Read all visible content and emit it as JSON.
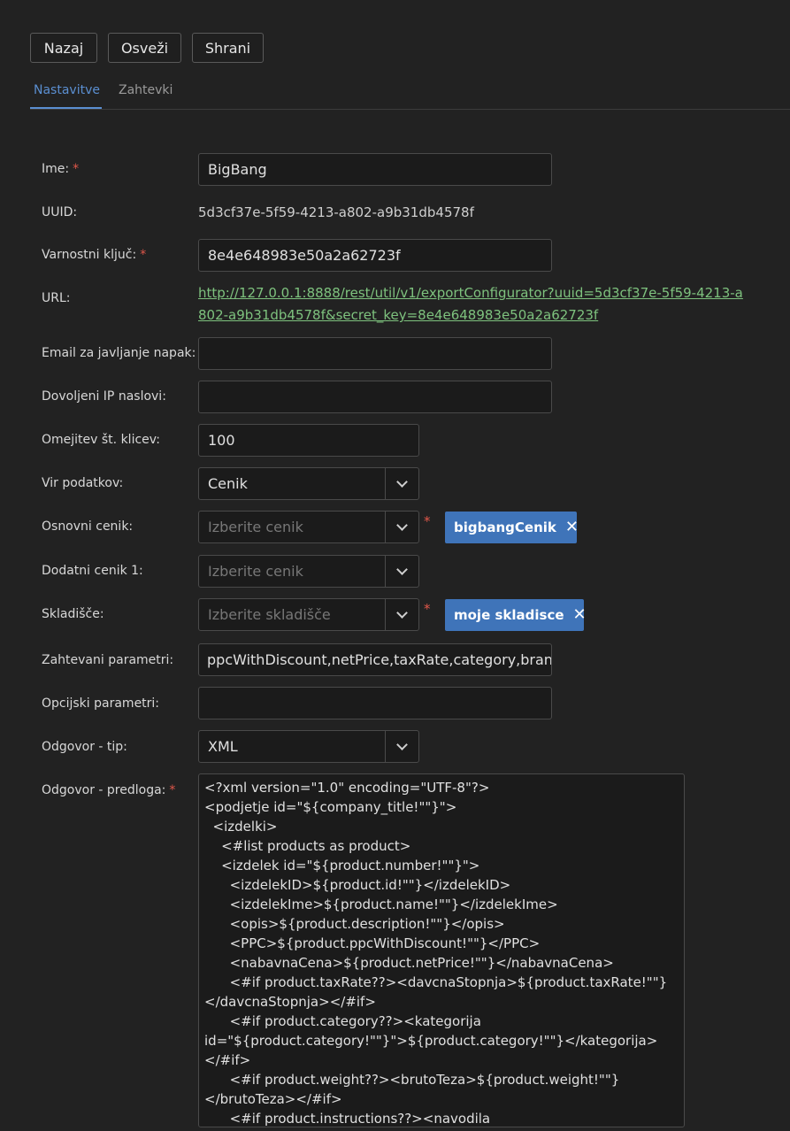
{
  "toolbar": {
    "back_label": "Nazaj",
    "refresh_label": "Osveži",
    "save_label": "Shrani"
  },
  "tabs": [
    {
      "label": "Nastavitve",
      "active": true
    },
    {
      "label": "Zahtevki",
      "active": false
    }
  ],
  "form": {
    "name": {
      "label": "Ime:",
      "value": "BigBang"
    },
    "uuid": {
      "label": "UUID:",
      "value": "5d3cf37e-5f59-4213-a802-a9b31db4578f"
    },
    "secret_key": {
      "label": "Varnostni ključ:",
      "value": "8e4e648983e50a2a62723f"
    },
    "url": {
      "label": "URL:",
      "value": "http://127.0.0.1:8888/rest/util/v1/exportConfigurator?uuid=5d3cf37e-5f59-4213-a802-a9b31db4578f&secret_key=8e4e648983e50a2a62723f"
    },
    "error_email": {
      "label": "Email za javljanje napak:",
      "value": ""
    },
    "allowed_ips": {
      "label": "Dovoljeni IP naslovi:",
      "value": ""
    },
    "call_limit": {
      "label": "Omejitev št. klicev:",
      "value": "100"
    },
    "data_source": {
      "label": "Vir podatkov:",
      "value": "Cenik"
    },
    "base_pricelist": {
      "label": "Osnovni cenik:",
      "placeholder": "Izberite cenik",
      "tag": "bigbangCenik"
    },
    "extra_pricelist_1": {
      "label": "Dodatni cenik 1:",
      "placeholder": "Izberite cenik"
    },
    "warehouse": {
      "label": "Skladišče:",
      "placeholder": "Izberite skladišče",
      "tag": "moje skladisce"
    },
    "required_params": {
      "label": "Zahtevani parametri:",
      "value": "ppcWithDiscount,netPrice,taxRate,category,brand"
    },
    "optional_params": {
      "label": "Opcijski parametri:",
      "value": ""
    },
    "response_type": {
      "label": "Odgovor - tip:",
      "value": "XML"
    },
    "response_template": {
      "label": "Odgovor - predloga:",
      "value": "<?xml version=\"1.0\" encoding=\"UTF-8\"?>\n<podjetje id=\"${company_title!\"\"}\">\n  <izdelki>\n    <#list products as product>\n    <izdelek id=\"${product.number!\"\"}\">\n      <izdelekID>${product.id!\"\"}</izdelekID>\n      <izdelekIme>${product.name!\"\"}</izdelekIme>\n      <opis>${product.description!\"\"}</opis>\n      <PPC>${product.ppcWithDiscount!\"\"}</PPC>\n      <nabavnaCena>${product.netPrice!\"\"}</nabavnaCena>\n      <#if product.taxRate??><davcnaStopnja>${product.taxRate!\"\"}</davcnaStopnja></#if>\n      <#if product.category??><kategorija id=\"${product.category!\"\"}\">${product.category!\"\"}</kategorija></#if>\n      <#if product.weight??><brutoTeza>${product.weight!\"\"}</brutoTeza></#if>\n      <#if product.instructions??><navodila id=\"${product.instructions!\"\"}\">${product.instructions!\"\"}</navodila>"
    }
  },
  "colors": {
    "accent": "#5b8fd1",
    "tag_bg": "#3f74b9",
    "required": "#e0574a",
    "link": "#7ec27e"
  }
}
